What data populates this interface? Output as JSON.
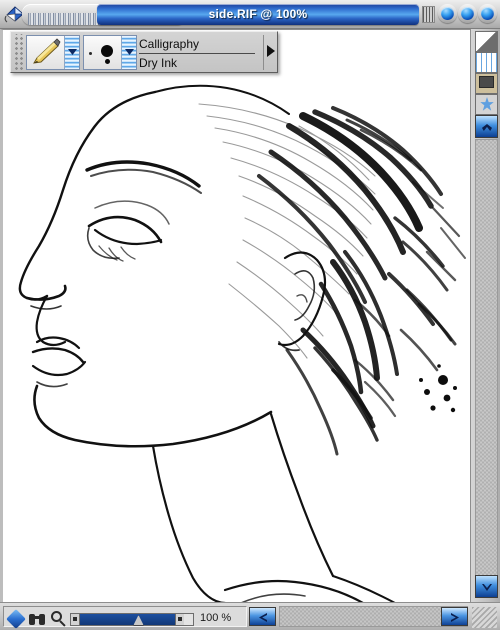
{
  "window": {
    "title": "side.RIF @ 100%",
    "bucket_icon": "paint-bucket-icon",
    "buttons": [
      {
        "name": "window-button-1",
        "label": ""
      },
      {
        "name": "window-button-2",
        "label": ""
      },
      {
        "name": "window-button-3",
        "label": ""
      }
    ]
  },
  "brush_panel": {
    "tool_icon": "calligraphy-pen-icon",
    "variant_icon": "round-dot-brush-tip-icon",
    "category_label": "Calligraphy",
    "variant_label": "Dry Ink",
    "expand_arrow": "triangle-right-icon",
    "drag_handle": "panel-drag-handle"
  },
  "right_strip": {
    "icons": [
      {
        "name": "split-square-icon"
      },
      {
        "name": "grid-icon"
      },
      {
        "name": "monitor-icon"
      },
      {
        "name": "star-icon"
      }
    ],
    "scroll_up": "scroll-up-arrow-icon",
    "scroll_down": "scroll-down-arrow-icon"
  },
  "status_bar": {
    "diamond_icon": "diamond-icon",
    "binoculars_icon": "binoculars-icon",
    "magnifier_icon": "magnifier-icon",
    "zoom_value": "100 %",
    "zoom_slider_percent": 50,
    "prev_icon": "arrow-left-icon",
    "next_icon": "arrow-right-icon",
    "resize_grip": "resize-grip"
  },
  "artwork": {
    "description": "Black ink line-art profile portrait of a woman facing left, with bold calligraphic hair strokes",
    "ink_color": "#111111",
    "paper_color": "#ffffff"
  }
}
